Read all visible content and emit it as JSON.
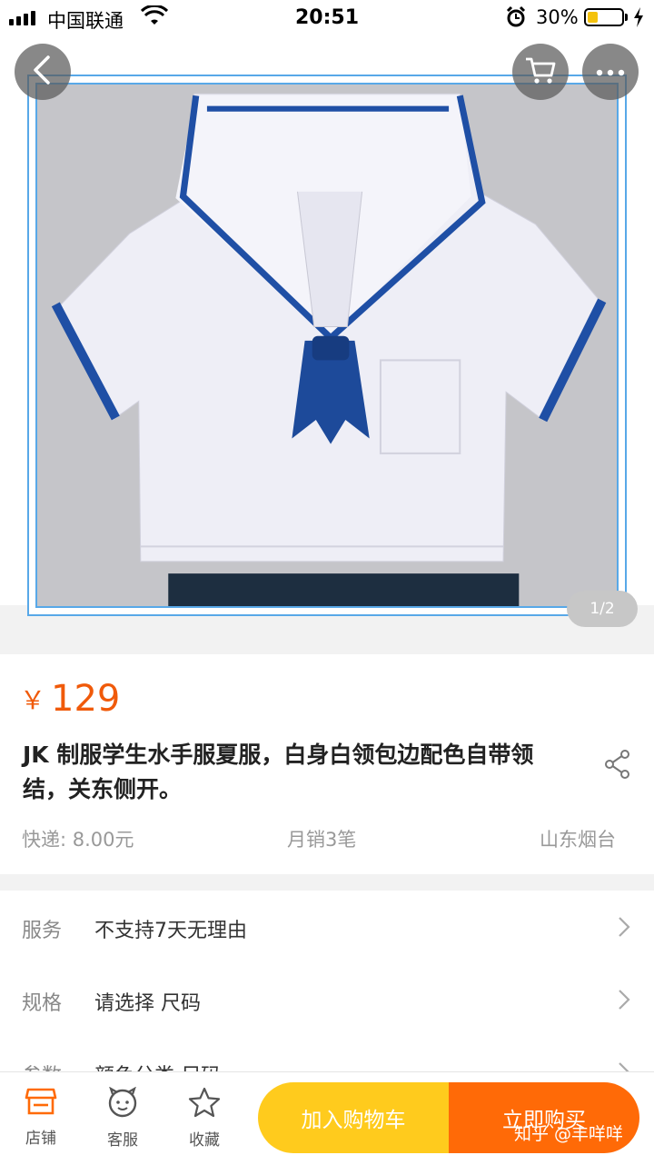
{
  "status_bar": {
    "carrier": "中国联通",
    "time": "20:51",
    "battery_percent": "30%",
    "battery_level": 0.3
  },
  "gallery": {
    "page_indicator": "1/2",
    "icons": {
      "back": "chevron-left-icon",
      "cart": "cart-icon",
      "more": "more-dots-icon"
    }
  },
  "product": {
    "currency": "￥",
    "price": "129",
    "title": "JK 制服学生水手服夏服，白身白领包边配色自带领结，关东侧开。",
    "shipping": "快递: 8.00元",
    "monthly_sales": "月销3笔",
    "location": "山东烟台"
  },
  "services": [
    {
      "label": "服务",
      "value": "不支持7天无理由"
    },
    {
      "label": "规格",
      "value": "请选择 尺码"
    },
    {
      "label": "参数",
      "value": "颜色分类 尺码"
    }
  ],
  "bottom_bar": {
    "shop": "店铺",
    "service": "客服",
    "favorite": "收藏",
    "add_to_cart": "加入购物车",
    "buy_now": "立即购买"
  },
  "watermark": "知乎 @丰咩咩",
  "colors": {
    "price": "#f05a0a",
    "cart_button": "#ffcb1d",
    "buy_button": "#ff6a07",
    "frame_border": "#58a8e8"
  }
}
